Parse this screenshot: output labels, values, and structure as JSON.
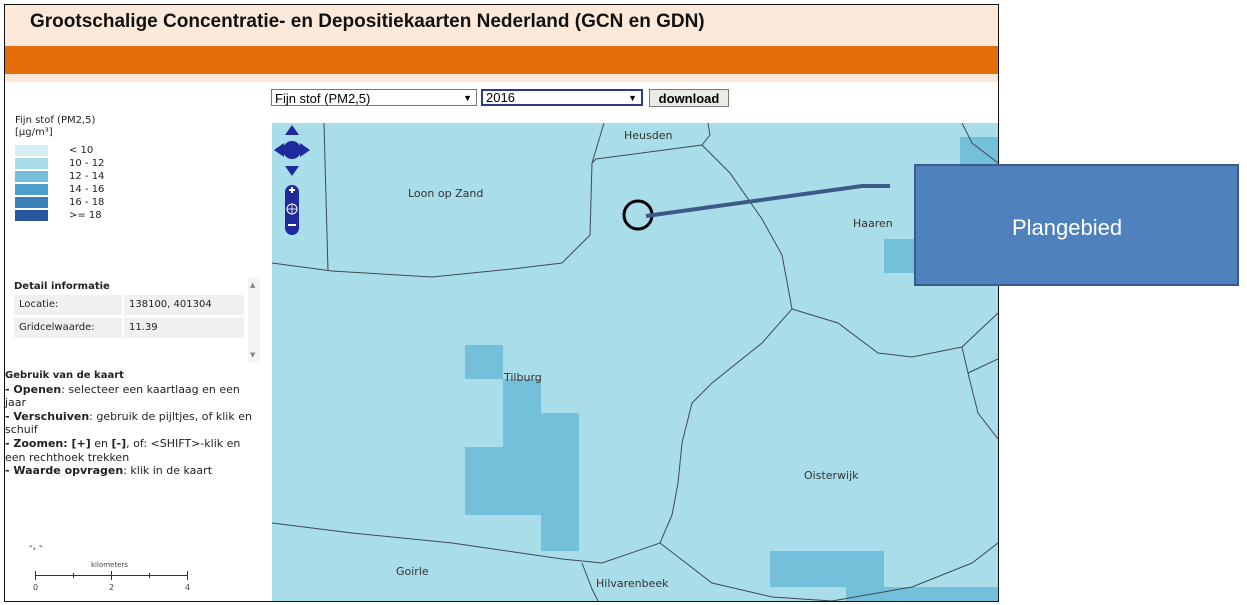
{
  "app": {
    "title": "Grootschalige Concentratie- en Depositiekaarten Nederland (GCN en GDN)"
  },
  "controls": {
    "layer_select": {
      "value": "Fijn stof (PM2,5)"
    },
    "year_select": {
      "value": "2016"
    },
    "download_label": "download"
  },
  "legend": {
    "title_line1": "Fijn stof (PM2,5)",
    "title_line2": "[µg/m³]",
    "items": [
      {
        "label": "< 10",
        "color": "#d6eff6"
      },
      {
        "label": "10 - 12",
        "color": "#a9dde9"
      },
      {
        "label": "12 - 14",
        "color": "#74bfda"
      },
      {
        "label": "14 - 16",
        "color": "#4e9fcb"
      },
      {
        "label": "16 - 18",
        "color": "#3a7fb8"
      },
      {
        "label": ">= 18",
        "color": "#2857a0"
      }
    ]
  },
  "detail": {
    "title": "Detail informatie",
    "rows": [
      {
        "key": "Locatie:",
        "value": "138100, 401304"
      },
      {
        "key": "Gridcelwaarde:",
        "value": "11.39"
      }
    ]
  },
  "usage": {
    "title": "Gebruik van de kaart",
    "open_b": "- Openen",
    "open_t": ": selecteer een kaartlaag en een jaar",
    "move_b": "- Verschuiven",
    "move_t": ": gebruik de pijltjes, of klik en schuif",
    "zoom_b": "- Zoomen: [+]",
    "zoom_m": " en ",
    "zoom_b2": "[-]",
    "zoom_t": ", of: <SHIFT>-klik en een rechthoek trekken",
    "value_b": "- Waarde opvragen",
    "value_t": ": klik in de kaart"
  },
  "coords": "-, -",
  "scale": {
    "unit": "kilometers",
    "labels": [
      "0",
      "2",
      "4"
    ]
  },
  "map": {
    "places": [
      "Heusden",
      "Loon op Zand",
      "Haaren",
      "Tilburg",
      "Oisterwijk",
      "Goirle",
      "Hilvarenbeek"
    ]
  },
  "annotation": {
    "label": "Plangebied"
  },
  "colors": {
    "header_bg": "#fde9d9",
    "orange_band": "#e46c0a",
    "map_base": "#a9dde9",
    "callout": "#4f81bd",
    "nav": "#1f2a9c"
  }
}
